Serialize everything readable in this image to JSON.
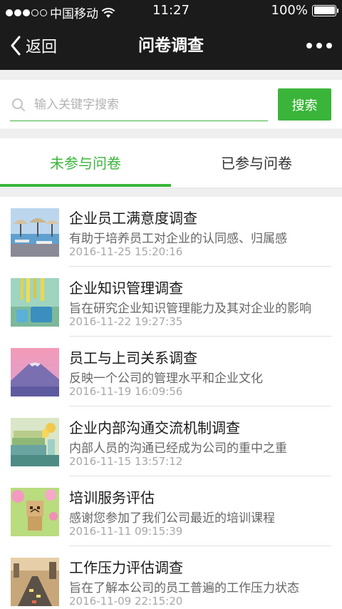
{
  "status_bar": {
    "carrier": "中国移动",
    "time": "11:27",
    "battery": "100%",
    "battery_level": 1.0
  },
  "nav": {
    "back_label": "返回",
    "title": "问卷调查"
  },
  "search": {
    "placeholder": "输入关键字搜索",
    "value": "",
    "button_label": "搜索"
  },
  "tabs": [
    {
      "label": "未参与问卷",
      "active": true
    },
    {
      "label": "已参与问卷",
      "active": false
    }
  ],
  "colors": {
    "accent": "#3ab53a",
    "header_bg": "#1b1b1b",
    "page_bg": "#efefef"
  },
  "surveys": [
    {
      "title": "企业员工满意度调查",
      "desc": "有助于培养员工对企业的认同感、归属感",
      "date": "2016-11-25 15:20:16",
      "thumb": "pool-umbrella-image"
    },
    {
      "title": "企业知识管理调查",
      "desc": "旨在研究企业知识管理能力及其对企业的影响",
      "date": "2016-11-22 19:27:35",
      "thumb": "colored-bottles-image"
    },
    {
      "title": "员工与上司关系调查",
      "desc": "反映一个公司的管理水平和企业文化",
      "date": "2016-11-19 16:09:56",
      "thumb": "mountain-sunset-image"
    },
    {
      "title": "企业内部沟通交流机制调查",
      "desc": "内部人员的沟通已经成为公司的重中之重",
      "date": "2016-11-15 13:57:12",
      "thumb": "books-flowers-image"
    },
    {
      "title": "培训服务评估",
      "desc": "感谢您参加了我们公司最近的培训课程",
      "date": "2016-11-11 09:15:39",
      "thumb": "danbo-figure-image"
    },
    {
      "title": "工作压力评估调查",
      "desc": "旨在了解本公司的员工普遍的工作压力状态",
      "date": "2016-11-09 22:15:20",
      "thumb": "city-traffic-image"
    }
  ]
}
